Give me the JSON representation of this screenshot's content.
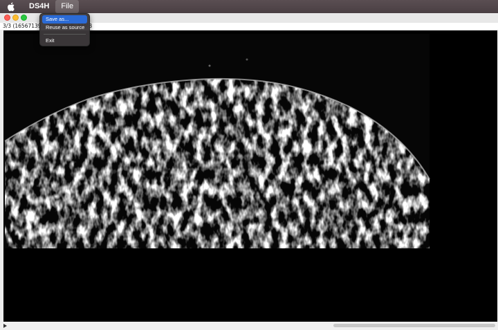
{
  "menubar": {
    "app_name": "DS4H",
    "file_label": "File"
  },
  "info": {
    "text": "3/3 (16567139... ixels; RGB; 11MB"
  },
  "file_menu": {
    "items": [
      {
        "label": "Save as...",
        "selected": true
      },
      {
        "label": "Reuse as source",
        "selected": false
      },
      {
        "label": "Exit",
        "selected": false
      }
    ]
  },
  "icons": {
    "apple": "apple-icon",
    "play": "play-icon"
  },
  "colors": {
    "close": "#fe5f57",
    "minimize": "#febc2e",
    "maximize": "#28c840",
    "menu_highlight": "#2b6bd6"
  }
}
